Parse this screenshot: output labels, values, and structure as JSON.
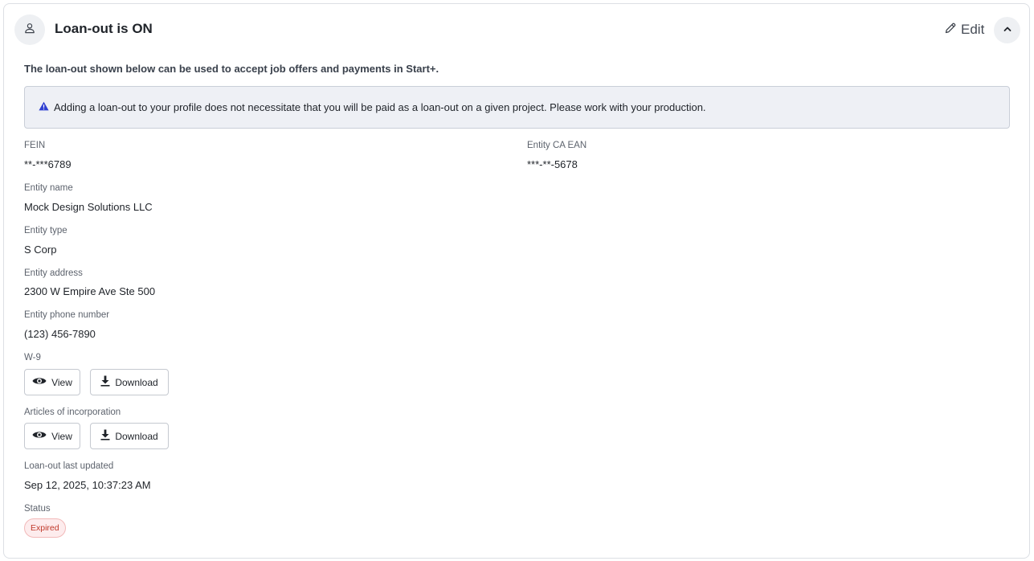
{
  "header": {
    "title": "Loan-out is ON",
    "edit_label": "Edit"
  },
  "intro": "The loan-out shown below can be used to accept job offers and payments in Start+.",
  "alert": {
    "message": "Adding a loan-out to your profile does not necessitate that you will be paid as a loan-out on a given project. Please work with your production."
  },
  "fields": {
    "fein": {
      "label": "FEIN",
      "value": "**-***6789"
    },
    "ca_ean": {
      "label": "Entity CA EAN",
      "value": "***-**-5678"
    },
    "entity_name": {
      "label": "Entity name",
      "value": "Mock Design Solutions LLC"
    },
    "entity_type": {
      "label": "Entity type",
      "value": "S Corp"
    },
    "entity_address": {
      "label": "Entity address",
      "value": "2300 W Empire Ave Ste 500"
    },
    "entity_phone": {
      "label": "Entity phone number",
      "value": "(123) 456-7890"
    },
    "last_updated": {
      "label": "Loan-out last updated",
      "value": "Sep 12, 2025, 10:37:23 AM"
    },
    "status": {
      "label": "Status",
      "value": "Expired"
    }
  },
  "documents": {
    "w9": {
      "label": "W-9",
      "view_label": "View",
      "download_label": "Download"
    },
    "articles": {
      "label": "Articles of incorporation",
      "view_label": "View",
      "download_label": "Download"
    }
  },
  "icons": {
    "avatar": "user-icon",
    "edit": "pencil-icon",
    "collapse": "chevron-up-icon",
    "alert": "warning-icon",
    "view": "eye-icon",
    "download": "download-icon"
  },
  "colors": {
    "alert_icon": "#2f3fd1",
    "status_badge_text": "#c0392b",
    "status_badge_bg": "#fdeced"
  }
}
